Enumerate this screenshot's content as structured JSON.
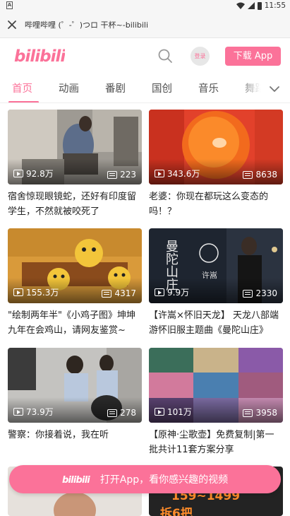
{
  "status_bar": {
    "time": "11:55"
  },
  "browser": {
    "title": "哔哩哔哩 (゜-゜)つロ 干杯~-bilibili"
  },
  "header": {
    "logo": "bilibili",
    "login_label": "登录",
    "download_label": "下载 App"
  },
  "tabs": [
    {
      "label": "首页",
      "active": true
    },
    {
      "label": "动画",
      "active": false
    },
    {
      "label": "番剧",
      "active": false
    },
    {
      "label": "国创",
      "active": false
    },
    {
      "label": "音乐",
      "active": false
    },
    {
      "label": "舞蹈",
      "active": false
    }
  ],
  "videos": [
    {
      "views": "92.8万",
      "danmaku": "223",
      "title": "宿舍惊现眼镜蛇，还好有印度留学生，不然就被咬死了"
    },
    {
      "views": "343.6万",
      "danmaku": "8638",
      "title": "老婆：你现在都玩这么变态的吗！？"
    },
    {
      "views": "155.3万",
      "danmaku": "4317",
      "title": "\"绘制两年半\"《小鸡子图》坤坤九年在会鸡山，请网友鉴赏~"
    },
    {
      "views": "9.9万",
      "danmaku": "2330",
      "title": "【许嵩×怀旧天龙】 天龙八部端游怀旧服主题曲《曼陀山庄》"
    },
    {
      "views": "73.9万",
      "danmaku": "278",
      "title": "警察：你接着说，我在听"
    },
    {
      "views": "101万",
      "danmaku": "3958",
      "title": "【原神·尘歌壶】免费复制|第一批共计11套方案分享"
    }
  ],
  "thumb_text": {
    "v4_main": "曼陀山庄",
    "v4_artist": "许嵩",
    "v8_line1": "159~1499",
    "v8_line2": "拆6把"
  },
  "open_app": {
    "label": "打开App，看你感兴趣的视频",
    "logo": "bilibili"
  },
  "colors": {
    "accent": "#fb7299",
    "text": "#212121"
  }
}
